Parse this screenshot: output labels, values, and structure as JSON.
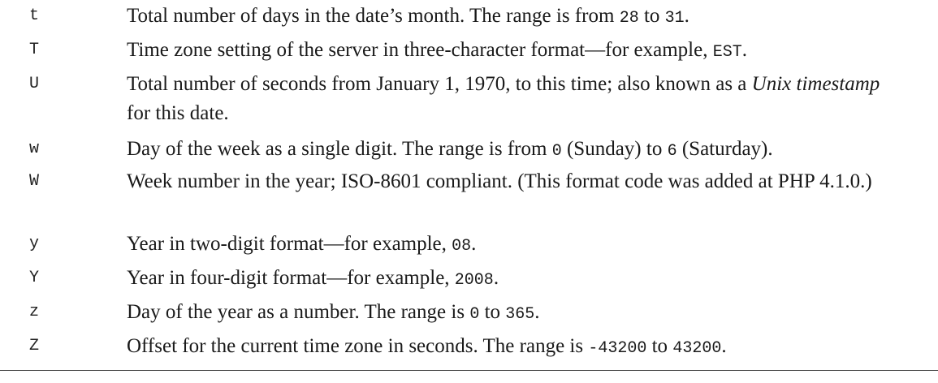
{
  "rows": [
    {
      "code": "t",
      "desc_a": "Total number of days in the date’s month. The range is from ",
      "mono_a": "28",
      "desc_b": " to ",
      "mono_b": "31",
      "desc_c": "."
    },
    {
      "code": "T",
      "desc_a": "Time zone setting of the server in three-character format—for example, ",
      "mono_a": "EST",
      "desc_b": "."
    },
    {
      "code": "U",
      "desc_a": "Total number of seconds from January 1, 1970, to this time; also known as a ",
      "em_a": "Unix timestamp",
      "desc_b": " for this date."
    },
    {
      "code": "w",
      "desc_a": "Day of the week as a single digit. The range is from ",
      "mono_a": "0",
      "desc_b": " (Sunday) to ",
      "mono_b": "6",
      "desc_c": " (Saturday)."
    },
    {
      "code": "W",
      "desc_a": "Week number in the year; ISO-8601 compliant. (This format code was added at PHP 4.1.0.)"
    },
    {
      "code": "y",
      "desc_a": "Year in two-digit format—for example, ",
      "mono_a": "08",
      "desc_b": "."
    },
    {
      "code": "Y",
      "desc_a": "Year in four-digit format—for example, ",
      "mono_a": "2008",
      "desc_b": "."
    },
    {
      "code": "z",
      "desc_a": "Day of the year as a number. The range is ",
      "mono_a": "0",
      "desc_b": " to ",
      "mono_b": "365",
      "desc_c": "."
    },
    {
      "code": "Z",
      "desc_a": "Offset for the current time zone in seconds. The range is ",
      "mono_a": "-43200",
      "desc_b": " to ",
      "mono_b": "43200",
      "desc_c": "."
    }
  ]
}
